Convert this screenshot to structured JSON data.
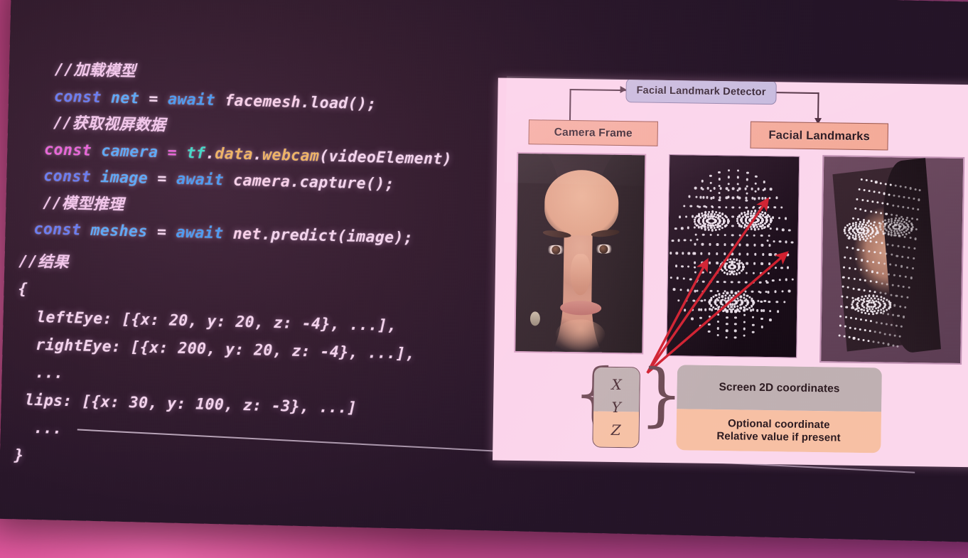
{
  "scene": {
    "description": "Photo of a projection screen showing a programming slide",
    "wall_color": "#d8488f",
    "screen_color": "#2e1a2b",
    "panel_color": "#fbd7ec"
  },
  "code": {
    "language": "javascript",
    "lines": [
      {
        "indent": 1,
        "tokens": [
          {
            "t": "//加载模型",
            "c": "cmt"
          }
        ]
      },
      {
        "indent": 1,
        "tokens": [
          {
            "t": "const",
            "c": "kw"
          },
          {
            "t": " ",
            "c": "pl"
          },
          {
            "t": "net",
            "c": "var"
          },
          {
            "t": " = ",
            "c": "pl"
          },
          {
            "t": "await",
            "c": "awt"
          },
          {
            "t": " ",
            "c": "pl"
          },
          {
            "t": "facemesh",
            "c": "fn"
          },
          {
            "t": ".load();",
            "c": "pl"
          }
        ]
      },
      {
        "indent": 1,
        "tokens": [
          {
            "t": "//获取视屏数据",
            "c": "cmt"
          }
        ]
      },
      {
        "indent": 0,
        "tokens": [
          {
            "t": "const",
            "c": "kw2"
          },
          {
            "t": " ",
            "c": "pl"
          },
          {
            "t": "camera",
            "c": "var"
          },
          {
            "t": " ",
            "c": "pl"
          },
          {
            "t": "=",
            "c": "kw2"
          },
          {
            "t": " ",
            "c": "pl"
          },
          {
            "t": "tf",
            "c": "tf"
          },
          {
            "t": ".",
            "c": "pl"
          },
          {
            "t": "data",
            "c": "prop"
          },
          {
            "t": ".",
            "c": "pl"
          },
          {
            "t": "webcam",
            "c": "prop"
          },
          {
            "t": "(videoElement)",
            "c": "pl"
          }
        ]
      },
      {
        "indent": 0,
        "tokens": [
          {
            "t": "const",
            "c": "kw"
          },
          {
            "t": " ",
            "c": "pl"
          },
          {
            "t": "image",
            "c": "var"
          },
          {
            "t": " = ",
            "c": "pl"
          },
          {
            "t": "await",
            "c": "awt"
          },
          {
            "t": " ",
            "c": "pl"
          },
          {
            "t": "camera",
            "c": "fn"
          },
          {
            "t": ".capture();",
            "c": "pl"
          }
        ]
      },
      {
        "indent": 0,
        "tokens": [
          {
            "t": "//模型推理",
            "c": "cmt"
          }
        ]
      },
      {
        "indent": -1,
        "tokens": [
          {
            "t": "const",
            "c": "kw"
          },
          {
            "t": " ",
            "c": "pl"
          },
          {
            "t": "meshes",
            "c": "var"
          },
          {
            "t": " = ",
            "c": "pl"
          },
          {
            "t": "await",
            "c": "awt"
          },
          {
            "t": " ",
            "c": "pl"
          },
          {
            "t": "net",
            "c": "fn"
          },
          {
            "t": ".predict(image);",
            "c": "pl"
          }
        ]
      }
    ],
    "result_block": [
      "//结果",
      "{",
      "  leftEye: [{x: 20, y: 20, z: -4}, ...],",
      "  rightEye: [{x: 200, y: 20, z: -4}, ...],",
      "  ...",
      " lips: [{x: 30, y: 100, z: -3}, ...]",
      "  ...",
      "}"
    ]
  },
  "diagram": {
    "title_node": "Facial Landmark Detector",
    "input_node": "Camera Frame",
    "output_node": "Facial Landmarks",
    "coordinate_axes": {
      "x": "X",
      "y": "Y",
      "z": "Z"
    },
    "legend": {
      "screen_coords": "Screen 2D coordinates",
      "optional_line1": "Optional coordinate",
      "optional_line2": "Relative value if present"
    },
    "tiles": [
      {
        "name": "camera-frame-photo",
        "caption": ""
      },
      {
        "name": "landmark-mesh-photo",
        "caption": ""
      },
      {
        "name": "landmarks-overlay-photo",
        "caption": ""
      }
    ],
    "colors": {
      "detector_fill": "#c3bade",
      "node_fill": "#f5ac9a",
      "panel_bg": "#fbd7ec",
      "arrow_red": "#d01f2e",
      "xy_fill": "#c0b2b2",
      "z_fill": "#f6c2a4"
    },
    "arrow_count": 3
  }
}
